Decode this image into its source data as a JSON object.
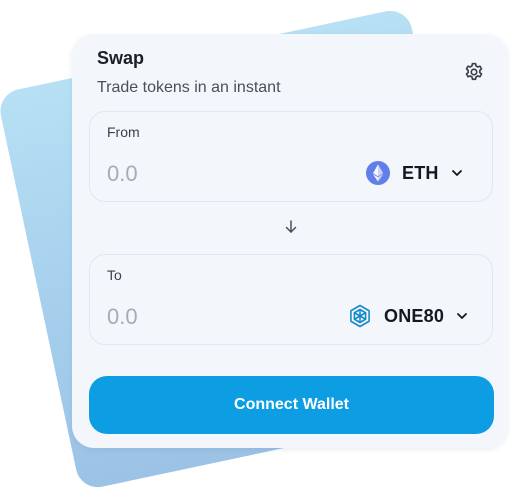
{
  "swap": {
    "title": "Swap",
    "subtitle": "Trade tokens in an instant"
  },
  "from": {
    "label": "From",
    "amount_placeholder": "0.0",
    "token": {
      "symbol": "ETH",
      "icon": "ethereum-icon",
      "icon_color": "#627eea"
    }
  },
  "to": {
    "label": "To",
    "amount_placeholder": "0.0",
    "token": {
      "symbol": "ONE80",
      "icon": "one80-icon",
      "icon_color": "#1689c9"
    }
  },
  "actions": {
    "connect_wallet": "Connect Wallet"
  },
  "colors": {
    "accent": "#0d9de3",
    "card_background": "#f3f7fc"
  }
}
